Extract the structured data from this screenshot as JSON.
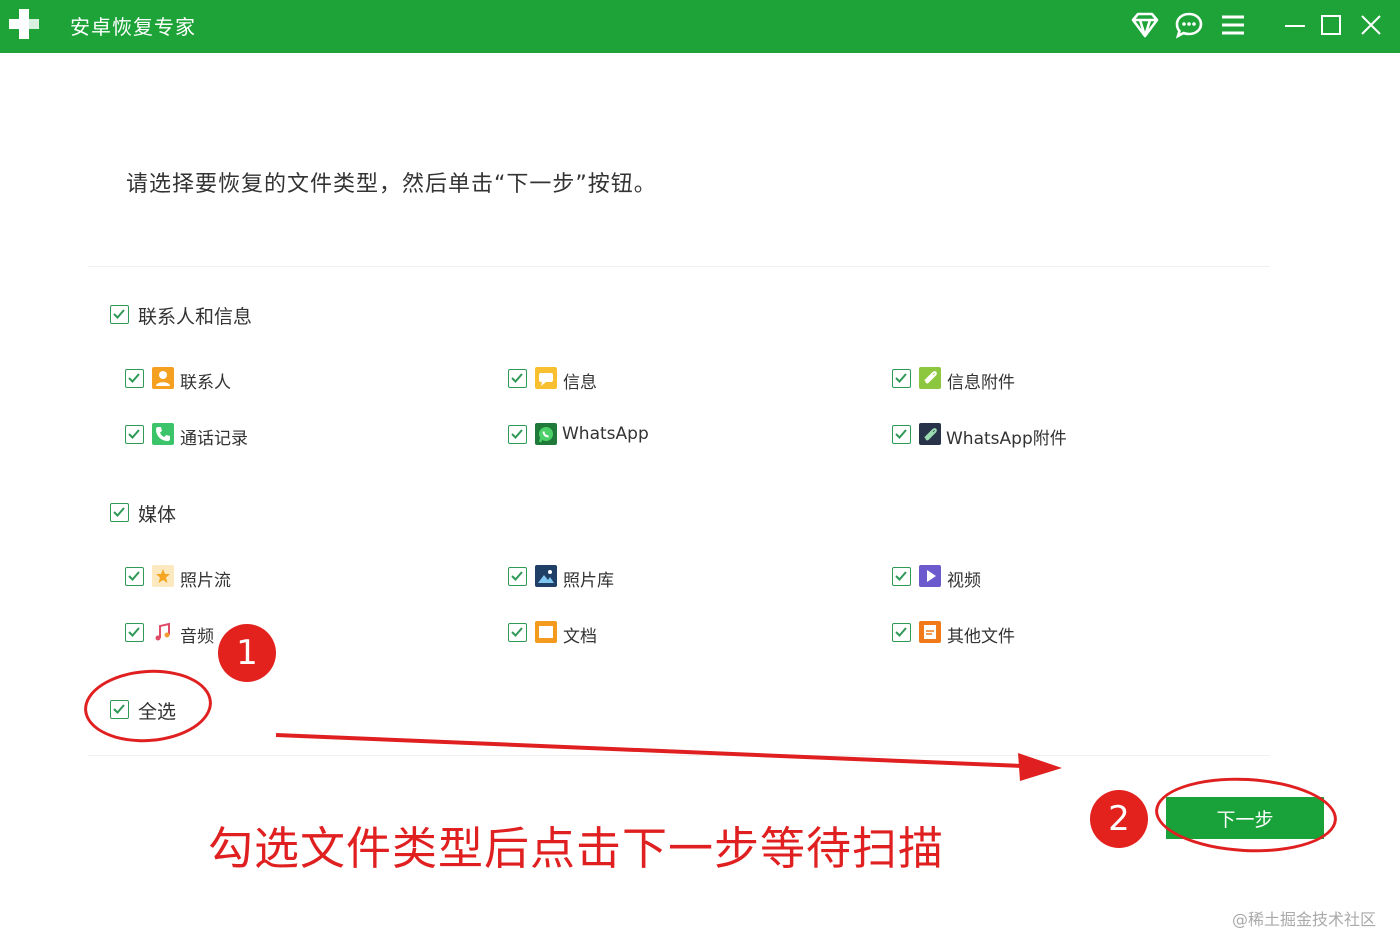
{
  "titlebar": {
    "title": "安卓恢复专家",
    "icons": [
      "plus-logo-icon",
      "diamond-icon",
      "chat-icon",
      "menu-icon",
      "minimize-icon",
      "maximize-icon",
      "close-icon"
    ]
  },
  "instruction": "请选择要恢复的文件类型，然后单击“下一步”按钮。",
  "groups": {
    "contacts": {
      "label": "联系人和信息",
      "checked": true,
      "items": {
        "contacts": {
          "label": "联系人",
          "checked": true,
          "icon": "contacts-icon"
        },
        "messages": {
          "label": "信息",
          "checked": true,
          "icon": "messages-icon"
        },
        "message_attachments": {
          "label": "信息附件",
          "checked": true,
          "icon": "message-attachment-icon"
        },
        "call_log": {
          "label": "通话记录",
          "checked": true,
          "icon": "phone-icon"
        },
        "whatsapp": {
          "label": "WhatsApp",
          "checked": true,
          "icon": "whatsapp-icon"
        },
        "whatsapp_attachments": {
          "label": "WhatsApp附件",
          "checked": true,
          "icon": "whatsapp-attachment-icon"
        }
      }
    },
    "media": {
      "label": "媒体",
      "checked": true,
      "items": {
        "photo_stream": {
          "label": "照片流",
          "checked": true,
          "icon": "star-photo-icon"
        },
        "photo_library": {
          "label": "照片库",
          "checked": true,
          "icon": "landscape-icon"
        },
        "video": {
          "label": "视频",
          "checked": true,
          "icon": "video-play-icon"
        },
        "audio": {
          "label": "音频",
          "checked": true,
          "icon": "music-note-icon"
        },
        "documents": {
          "label": "文档",
          "checked": true,
          "icon": "document-icon"
        },
        "other_files": {
          "label": "其他文件",
          "checked": true,
          "icon": "other-file-icon"
        }
      }
    }
  },
  "select_all": {
    "label": "全选",
    "checked": true
  },
  "next_button": "下一步",
  "annotation": {
    "badge1": "1",
    "badge2": "2",
    "text": "勾选文件类型后点击下一步等待扫描"
  },
  "watermark": "@稀土掘金技术社区",
  "colors": {
    "brand_green": "#1da338",
    "annotation_red": "#e02020",
    "checkbox_green": "#2f9a56"
  }
}
